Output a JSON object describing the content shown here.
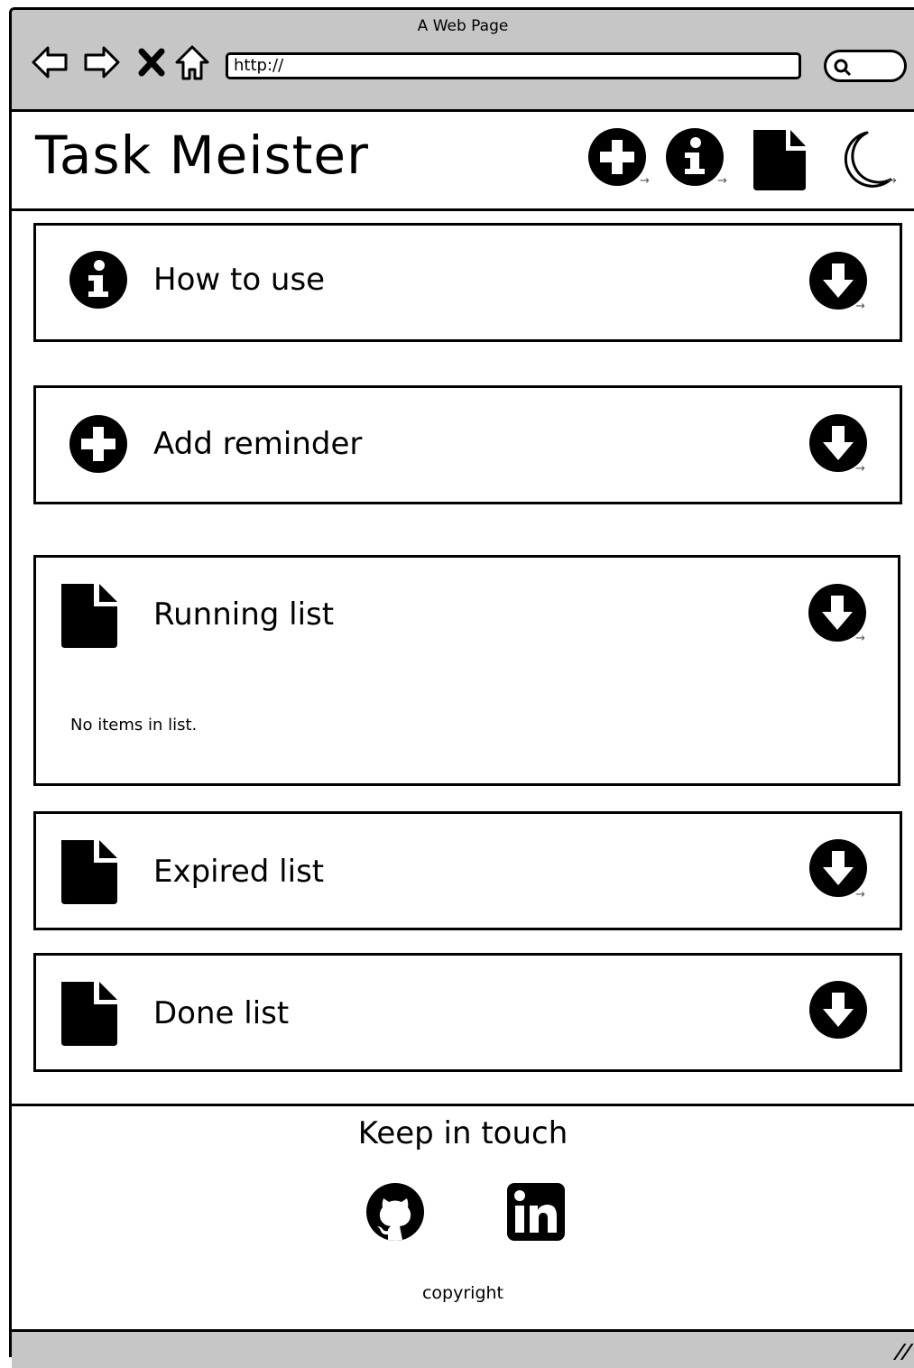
{
  "browser": {
    "window_title": "A Web Page",
    "url": "http://"
  },
  "header": {
    "title": "Task Meister"
  },
  "panels": [
    {
      "label": "How to use",
      "icon": "info-icon"
    },
    {
      "label": "Add reminder",
      "icon": "plus-icon"
    },
    {
      "label": "Running list",
      "icon": "file-icon",
      "body": "No items in list."
    },
    {
      "label": "Expired list",
      "icon": "file-icon"
    },
    {
      "label": "Done list",
      "icon": "file-icon"
    }
  ],
  "footer": {
    "title": "Keep in touch",
    "copyright": "copyright"
  }
}
